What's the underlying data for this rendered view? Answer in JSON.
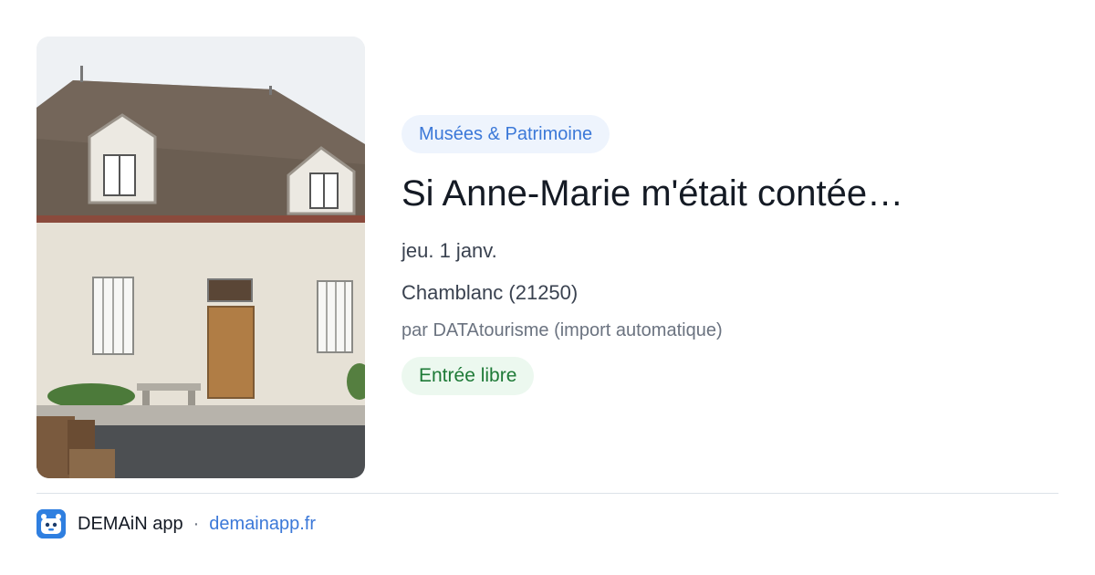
{
  "event": {
    "category": "Musées & Patrimoine",
    "title": "Si Anne-Marie m'était contée…",
    "date": "jeu. 1 janv.",
    "location": "Chamblanc (21250)",
    "author": "par DATAtourisme (import automatique)",
    "price": "Entrée libre"
  },
  "footer": {
    "brand": "DEMAiN app",
    "separator": "·",
    "domain": "demainapp.fr"
  },
  "colors": {
    "category_bg": "#eef4fd",
    "category_text": "#3b78d8",
    "price_bg": "#ecf8ef",
    "price_text": "#1e7a37",
    "link": "#3b78d8",
    "logo": "#2f7fe0"
  },
  "icons": {
    "logo": "demain-logo-icon"
  }
}
